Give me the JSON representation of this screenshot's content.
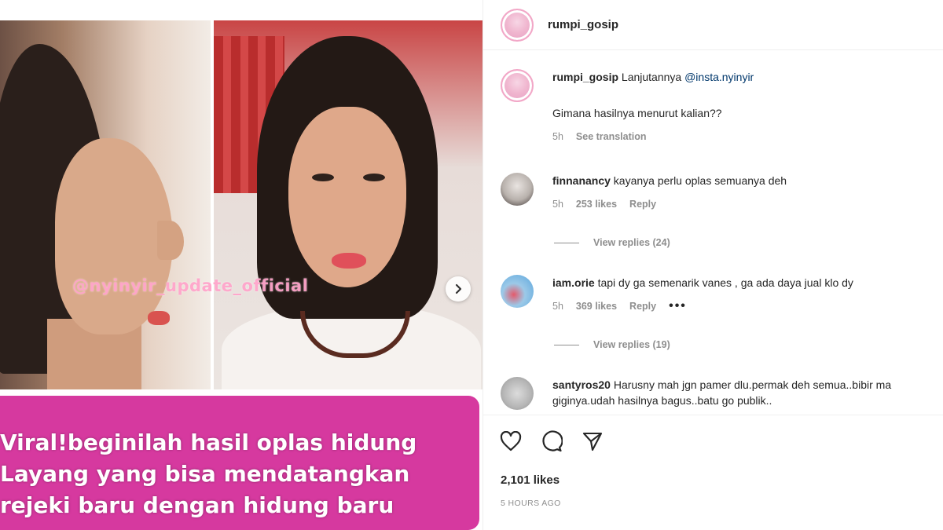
{
  "post": {
    "watermark": "@nyinyir_update_official",
    "caption_lines": [
      "Viral!beginilah hasil oplas hidung",
      "Layang yang bisa mendatangkan",
      "rejeki baru dengan hidung baru"
    ]
  },
  "header": {
    "username": "rumpi_gosip"
  },
  "caption": {
    "username": "rumpi_gosip",
    "text": "Lanjutannya ",
    "mention": "@insta.nyinyir",
    "second_line": "Gimana hasilnya menurut kalian??",
    "time": "5h",
    "translate": "See translation"
  },
  "comments": [
    {
      "username": "finnanancy",
      "text": "kayanya perlu oplas semuanya deh",
      "time": "5h",
      "likes": "253 likes",
      "reply": "Reply",
      "view_replies": "View replies (24)"
    },
    {
      "username": "iam.orie",
      "text": "tapi dy ga semenarik vanes , ga ada daya jual klo dy",
      "time": "5h",
      "likes": "369 likes",
      "reply": "Reply",
      "more": "•••",
      "view_replies": "View replies (19)"
    },
    {
      "username": "santyros20",
      "text": "Harusny mah jgn pamer dlu.permak deh semua..bibir ma giginya.udah hasilnya bagus..batu go publik.."
    }
  ],
  "footer": {
    "likes": "2,101 likes",
    "timestamp": "5 HOURS AGO"
  },
  "colors": {
    "banner": "#d6399f",
    "watermark": "#ffa0c8",
    "text_muted": "#8e8e8e",
    "mention": "#00376b"
  }
}
